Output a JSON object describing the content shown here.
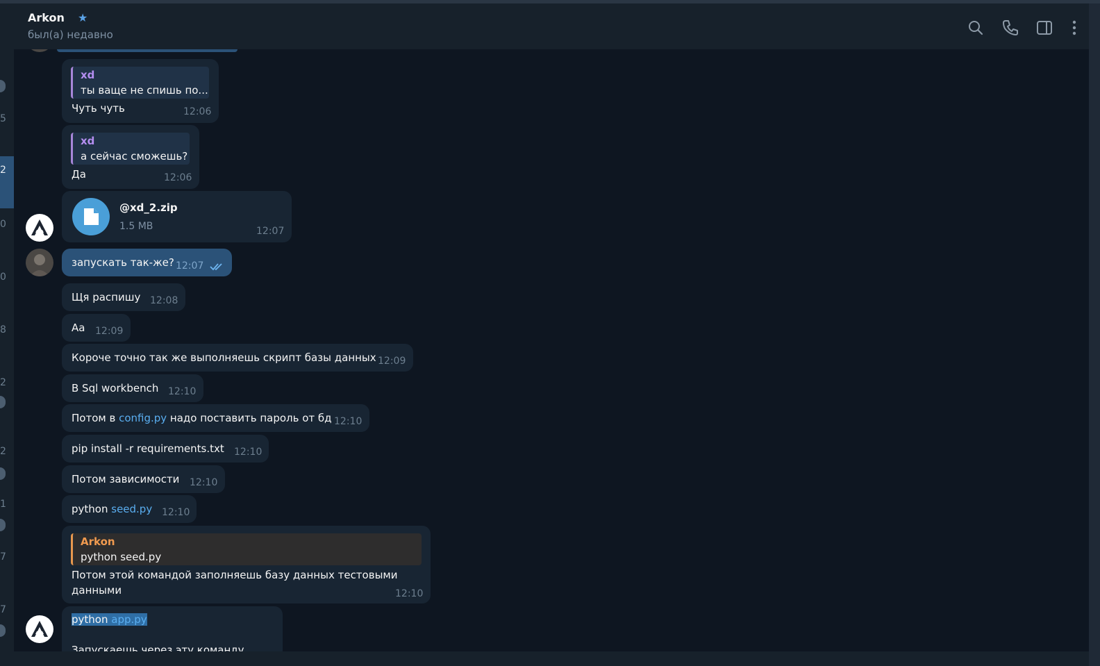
{
  "header": {
    "title": "Arkon",
    "star_icon": "star-icon",
    "status": "был(а) недавно",
    "icons": [
      "search-icon",
      "phone-icon",
      "sidebar-toggle-icon",
      "more-vertical-icon"
    ]
  },
  "left_panel_fragments": [
    "5",
    "2",
    "0",
    "0",
    "8",
    "2",
    "2",
    "1",
    "7",
    "7"
  ],
  "messages": [
    {
      "quote_name": "xd",
      "quote_text": "ты ваще не спишь по...",
      "text": "Чуть чуть",
      "time": "12:06"
    },
    {
      "quote_name": "xd",
      "quote_text": "а сейчас сможешь?",
      "text": "Да",
      "time": "12:06"
    },
    {
      "file_name": "@xd_2.zip",
      "file_size": "1.5 MB",
      "time": "12:07",
      "file_icon": "file-icon"
    },
    {
      "text": "запускать так-же?",
      "time": "12:07",
      "outgoing": true,
      "status_icon": "double-check-icon"
    },
    {
      "text": "Щя распишу",
      "time": "12:08"
    },
    {
      "text": "Аа",
      "time": "12:09"
    },
    {
      "text": "Короче точно так же выполняешь скрипт базы данных",
      "time": "12:09"
    },
    {
      "text": "В Sql workbench",
      "time": "12:10"
    },
    {
      "text_before": "Потом в ",
      "link": "config.py",
      "text_after": " надо поставить пароль от бд",
      "time": "12:10"
    },
    {
      "text": "pip install -r requirements.txt",
      "time": "12:10"
    },
    {
      "text": "Потом зависимости",
      "time": "12:10"
    },
    {
      "text_before": "python ",
      "link": "seed.py",
      "time": "12:10"
    },
    {
      "quote_name": "Arkon",
      "quote_text": "python seed.py",
      "line1": "Потом этой командой заполняешь базу данных тестовыми",
      "line2": "данными",
      "time": "12:10"
    },
    {
      "text_before": "python ",
      "link": "app.py",
      "line2": "Запускаешь через эту команду"
    }
  ],
  "colors": {
    "background": "#0e1621",
    "incoming_bubble": "#182533",
    "outgoing_bubble": "#2b5278",
    "accent": "#5aaef0",
    "quote_purple": "#a786d9",
    "quote_orange": "#e8984e"
  }
}
